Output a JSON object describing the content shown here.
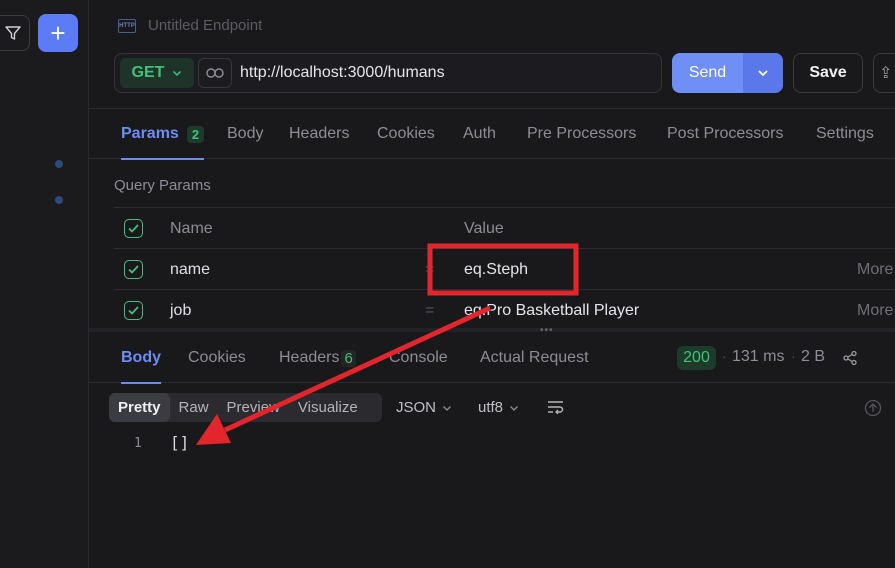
{
  "endpoint": {
    "title": "Untitled Endpoint",
    "icon": "http-icon"
  },
  "request": {
    "method": "GET",
    "url": "http://localhost:3000/humans",
    "send_label": "Send",
    "save_label": "Save"
  },
  "request_tabs": [
    {
      "label": "Params",
      "badge": "2",
      "active": true
    },
    {
      "label": "Body"
    },
    {
      "label": "Headers"
    },
    {
      "label": "Cookies"
    },
    {
      "label": "Auth"
    },
    {
      "label": "Pre Processors"
    },
    {
      "label": "Post Processors"
    },
    {
      "label": "Settings"
    }
  ],
  "query_params": {
    "title": "Query Params",
    "header": {
      "name": "Name",
      "value": "Value"
    },
    "rows": [
      {
        "name": "name",
        "eq": "=",
        "value": "eq.Steph",
        "more": "More",
        "checked": true
      },
      {
        "name": "job",
        "eq": "=",
        "value": "eq.Pro Basketball Player",
        "more": "More",
        "checked": true
      }
    ]
  },
  "response_tabs": [
    {
      "label": "Body",
      "active": true
    },
    {
      "label": "Cookies"
    },
    {
      "label": "Headers",
      "badge": "6"
    },
    {
      "label": "Console"
    },
    {
      "label": "Actual Request"
    }
  ],
  "response": {
    "status": "200",
    "time": "131 ms",
    "size": "2 B",
    "views": [
      "Pretty",
      "Raw",
      "Preview",
      "Visualize"
    ],
    "active_view": "Pretty",
    "format": "JSON",
    "encoding": "utf8",
    "lines": [
      {
        "no": "1",
        "text": "[]"
      }
    ]
  },
  "colors": {
    "accent": "#6d8cf4",
    "success": "#40c27a",
    "annotation": "#e3262c"
  }
}
